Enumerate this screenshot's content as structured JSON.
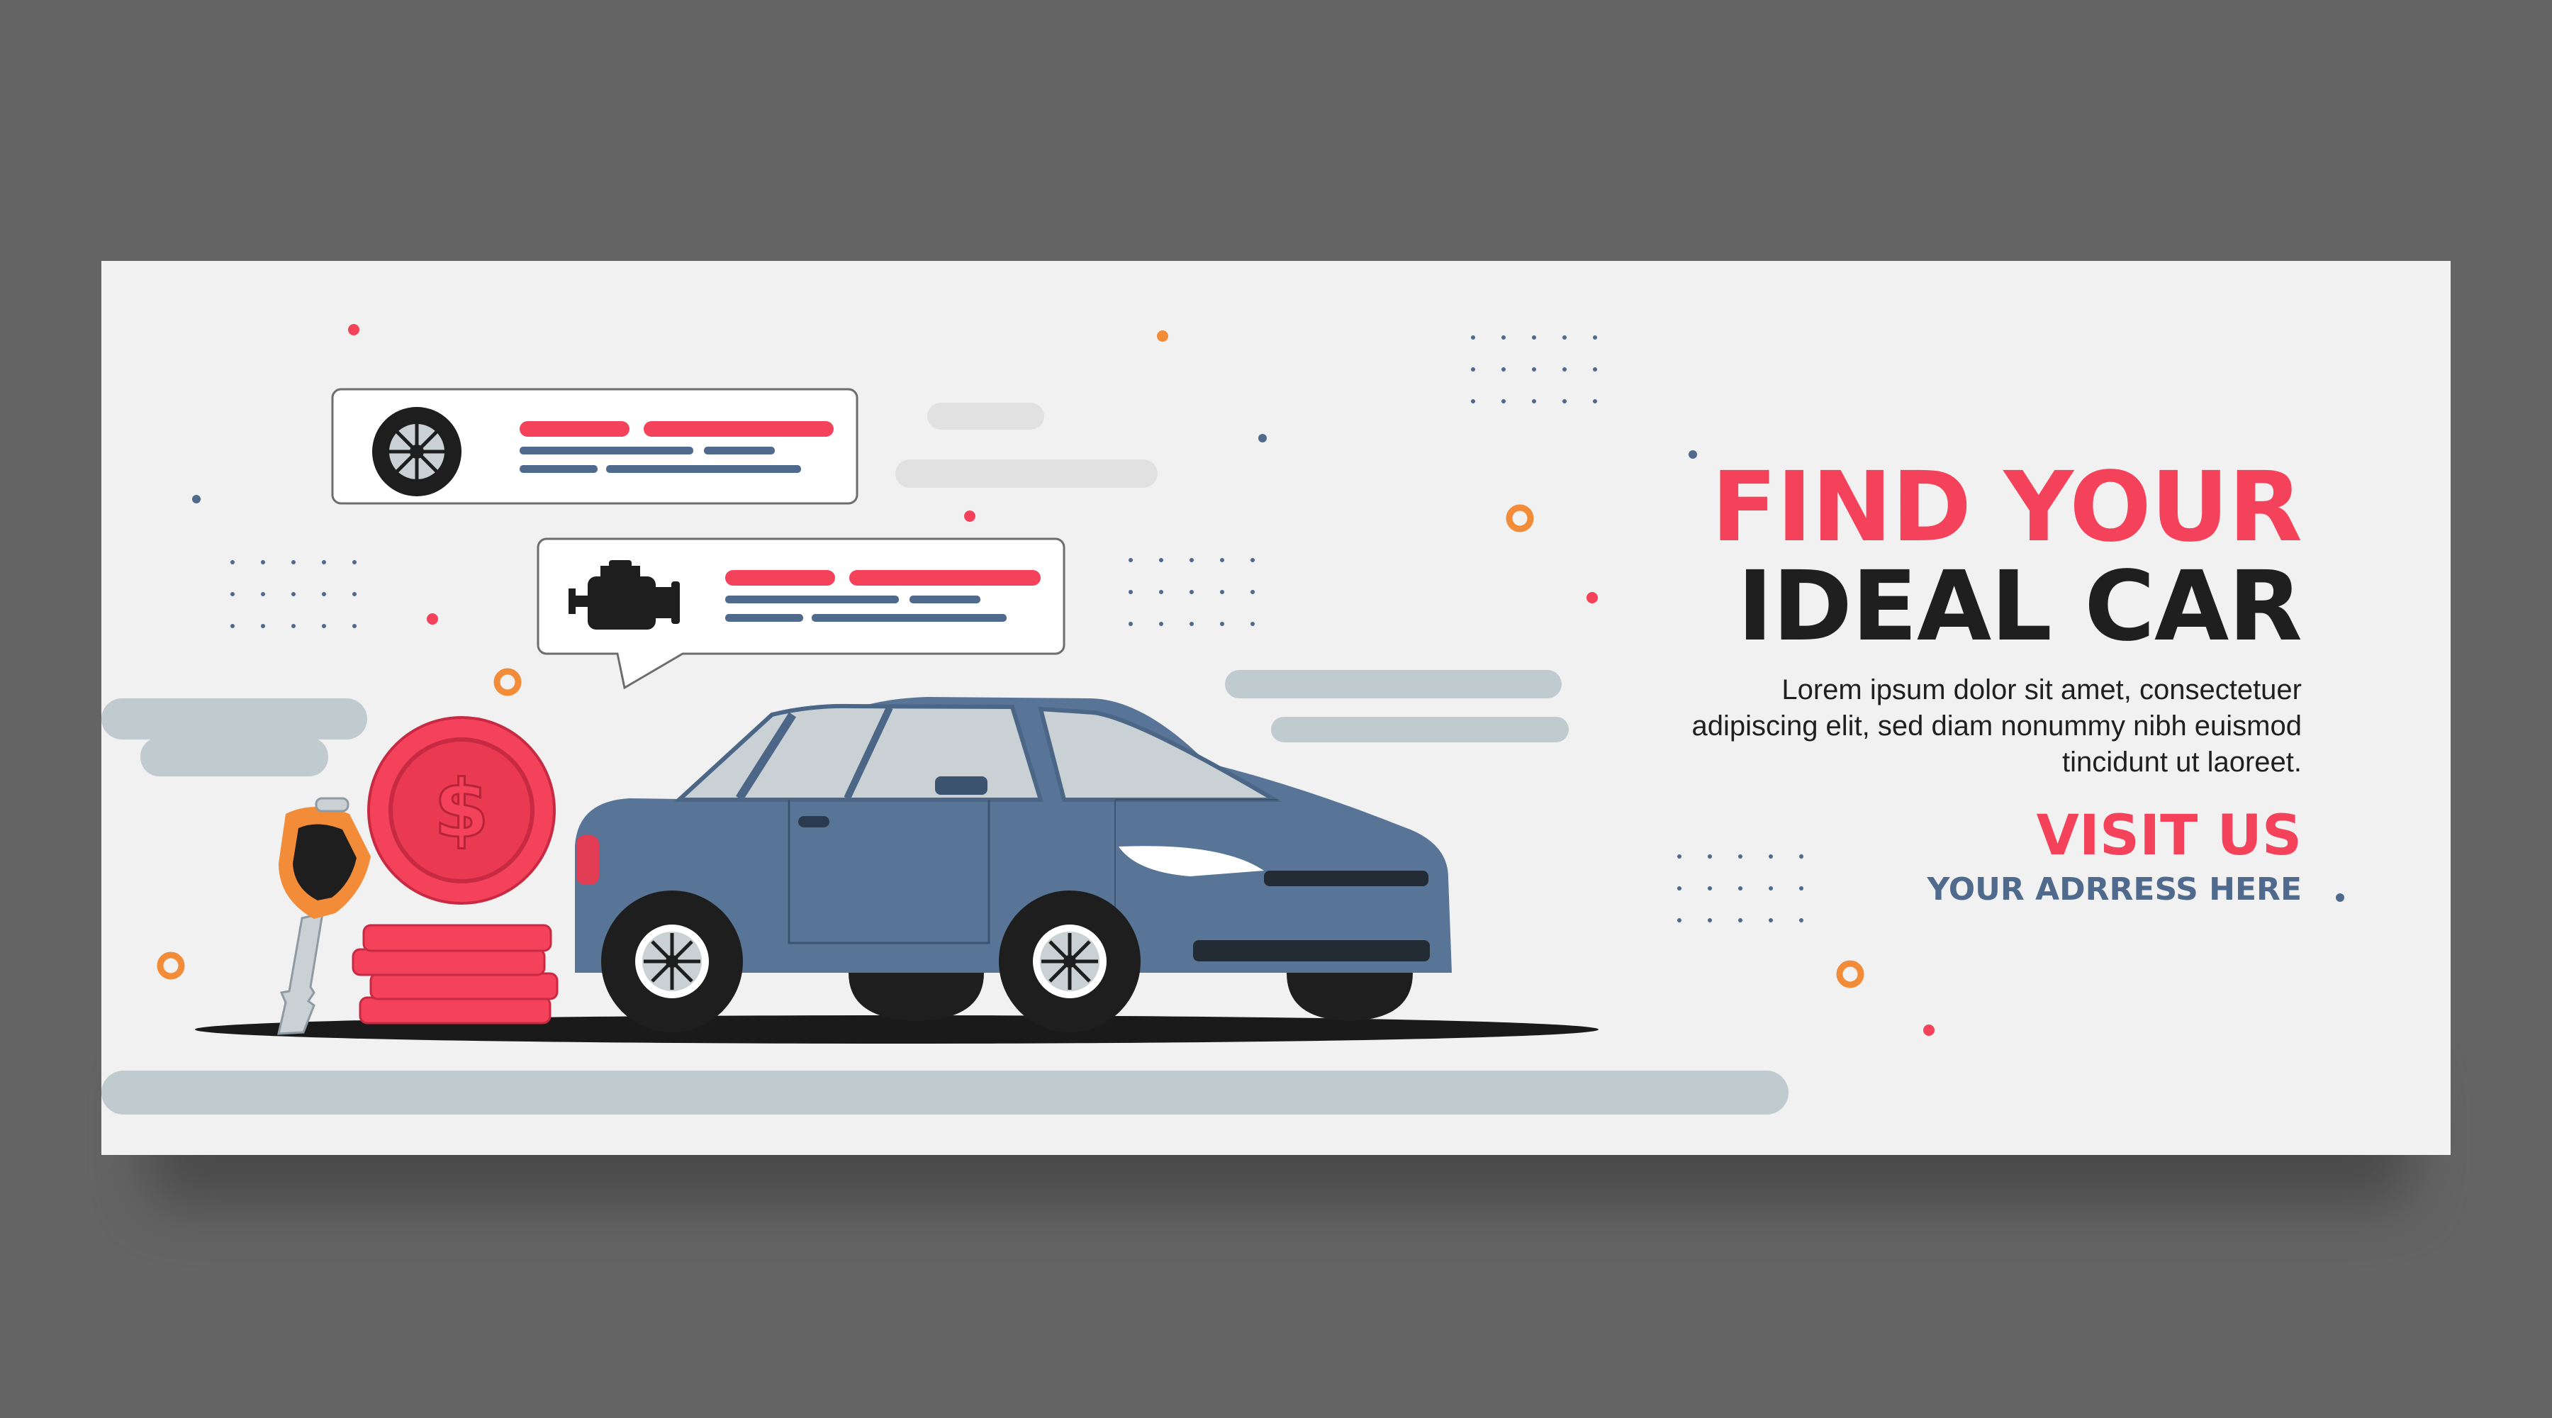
{
  "headline": {
    "line1": "FIND YOUR",
    "line2": "IDEAL CAR"
  },
  "description": "Lorem ipsum dolor sit amet, consectetuer adipiscing elit, sed diam nonummy nibh euismod tincidunt ut laoreet.",
  "cta": {
    "visit": "VISIT US",
    "address": "YOUR ADRRESS HERE"
  },
  "colors": {
    "accent_red": "#f4425b",
    "dark_text": "#1f1f1f",
    "slate_blue": "#4f6a8c",
    "car_body": "#587597",
    "orange": "#f28c38",
    "background": "#f1f1f1"
  },
  "icons": [
    "wheel-icon",
    "engine-icon",
    "dollar-coin-icon",
    "car-key-icon",
    "car-illustration"
  ]
}
